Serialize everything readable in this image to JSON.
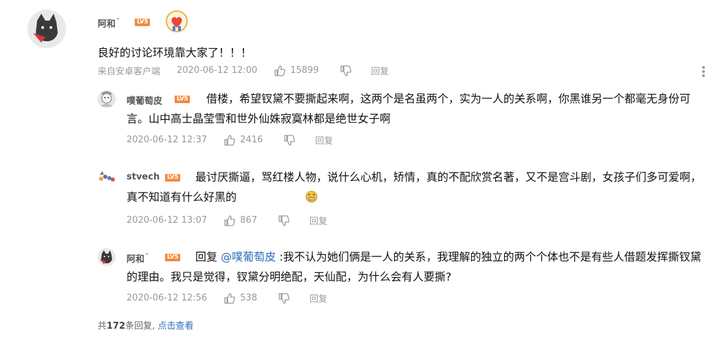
{
  "comment": {
    "author": "阿和",
    "author_mark": "゜",
    "level": "LV5",
    "content": "良好的讨论环境靠大家了！！！",
    "source": "来自安卓客户端",
    "time": "2020-06-12 12:00",
    "likes": "15899",
    "reply_label": "回复"
  },
  "replies": [
    {
      "author": "噗葡萄皮",
      "level": "LV5",
      "content": "借楼，希望钗黛不要撕起来啊，这两个是名虽两个，实为一人的关系啊，你黑谁另一个都毫无身份可言。山中高士晶莹雪和世外仙姝寂寞林都是绝世女子啊",
      "time": "2020-06-12 12:37",
      "likes": "2416",
      "reply_label": "回复"
    },
    {
      "author": "stvech",
      "level": "LV5",
      "content": "最讨厌撕逼，骂红楼人物，说什么心机，矫情，真的不配欣赏名著，又不是宫斗剧，女孩子们多可爱啊，真不知道有什么好黑的",
      "time": "2020-06-12 13:07",
      "likes": "867",
      "reply_label": "回复"
    },
    {
      "author": "阿和",
      "author_mark": "゜",
      "level": "LV5",
      "reply_prefix": "回复",
      "mention": "@噗葡萄皮",
      "content": ":我不认为她们俩是一人的关系，我理解的独立的两个个体也不是有些人借题发挥撕钗黛的理由。我只是觉得，钗黛分明绝配，天仙配，为什么会有人要撕?",
      "time": "2020-06-12 12:56",
      "likes": "538",
      "reply_label": "回复"
    }
  ],
  "footer": {
    "prefix": "共",
    "count": "172",
    "suffix": "条回复,",
    "link": "点击查看"
  },
  "icons": {
    "like": "thumbs-up-icon",
    "dislike": "thumbs-down-icon",
    "more": "more-vertical-icon",
    "medal": "heart-medal-icon"
  },
  "colors": {
    "level_badge": "#f4883a",
    "link": "#2f6dba",
    "meta": "#999999"
  }
}
